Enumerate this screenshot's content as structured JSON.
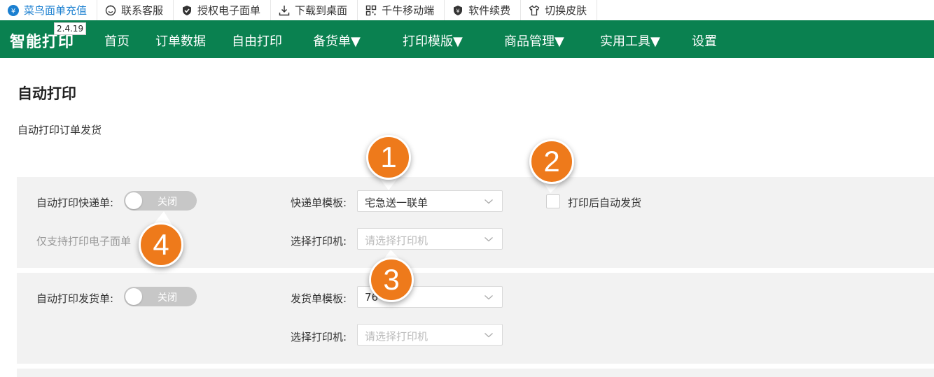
{
  "toolbar": {
    "items": [
      {
        "label": "菜鸟面单充值",
        "icon": "yen-icon"
      },
      {
        "label": "联系客服",
        "icon": "smile-icon"
      },
      {
        "label": "授权电子面单",
        "icon": "shield-check-icon"
      },
      {
        "label": "下载到桌面",
        "icon": "download-icon"
      },
      {
        "label": "千牛移动端",
        "icon": "qrcode-icon"
      },
      {
        "label": "软件续费",
        "icon": "shield-yen-icon"
      },
      {
        "label": "切换皮肤",
        "icon": "shirt-icon"
      }
    ]
  },
  "nav": {
    "brand": "智能打印",
    "version": "2.4.19",
    "items": [
      "首页",
      "订单数据",
      "自由打印",
      "备货单▼",
      "打印模版▼",
      "商品管理▼",
      "实用工具▼",
      "设置"
    ]
  },
  "page": {
    "title": "自动打印",
    "subtitle": "自动打印订单发货"
  },
  "express_panel": {
    "auto_print_label": "自动打印快递单:",
    "toggle_text": "关闭",
    "note": "仅支持打印电子面单",
    "template_label": "快递单模板:",
    "template_value": "宅急送一联单",
    "printer_label": "选择打印机:",
    "printer_placeholder": "请选择打印机",
    "auto_ship_label": "打印后自动发货"
  },
  "ship_panel": {
    "auto_print_label": "自动打印发货单:",
    "toggle_text": "关闭",
    "template_label": "发货单模板:",
    "template_value": "76",
    "printer_label": "选择打印机:",
    "printer_placeholder": "请选择打印机"
  },
  "markers": [
    "1",
    "2",
    "3",
    "4"
  ],
  "colors": {
    "nav_green": "#0a8150",
    "marker_orange": "#ee7a1b",
    "toolbar_link_blue": "#1a7fd0",
    "toggle_off": "#c7c7c7",
    "panel_bg": "#f2f2f2"
  }
}
